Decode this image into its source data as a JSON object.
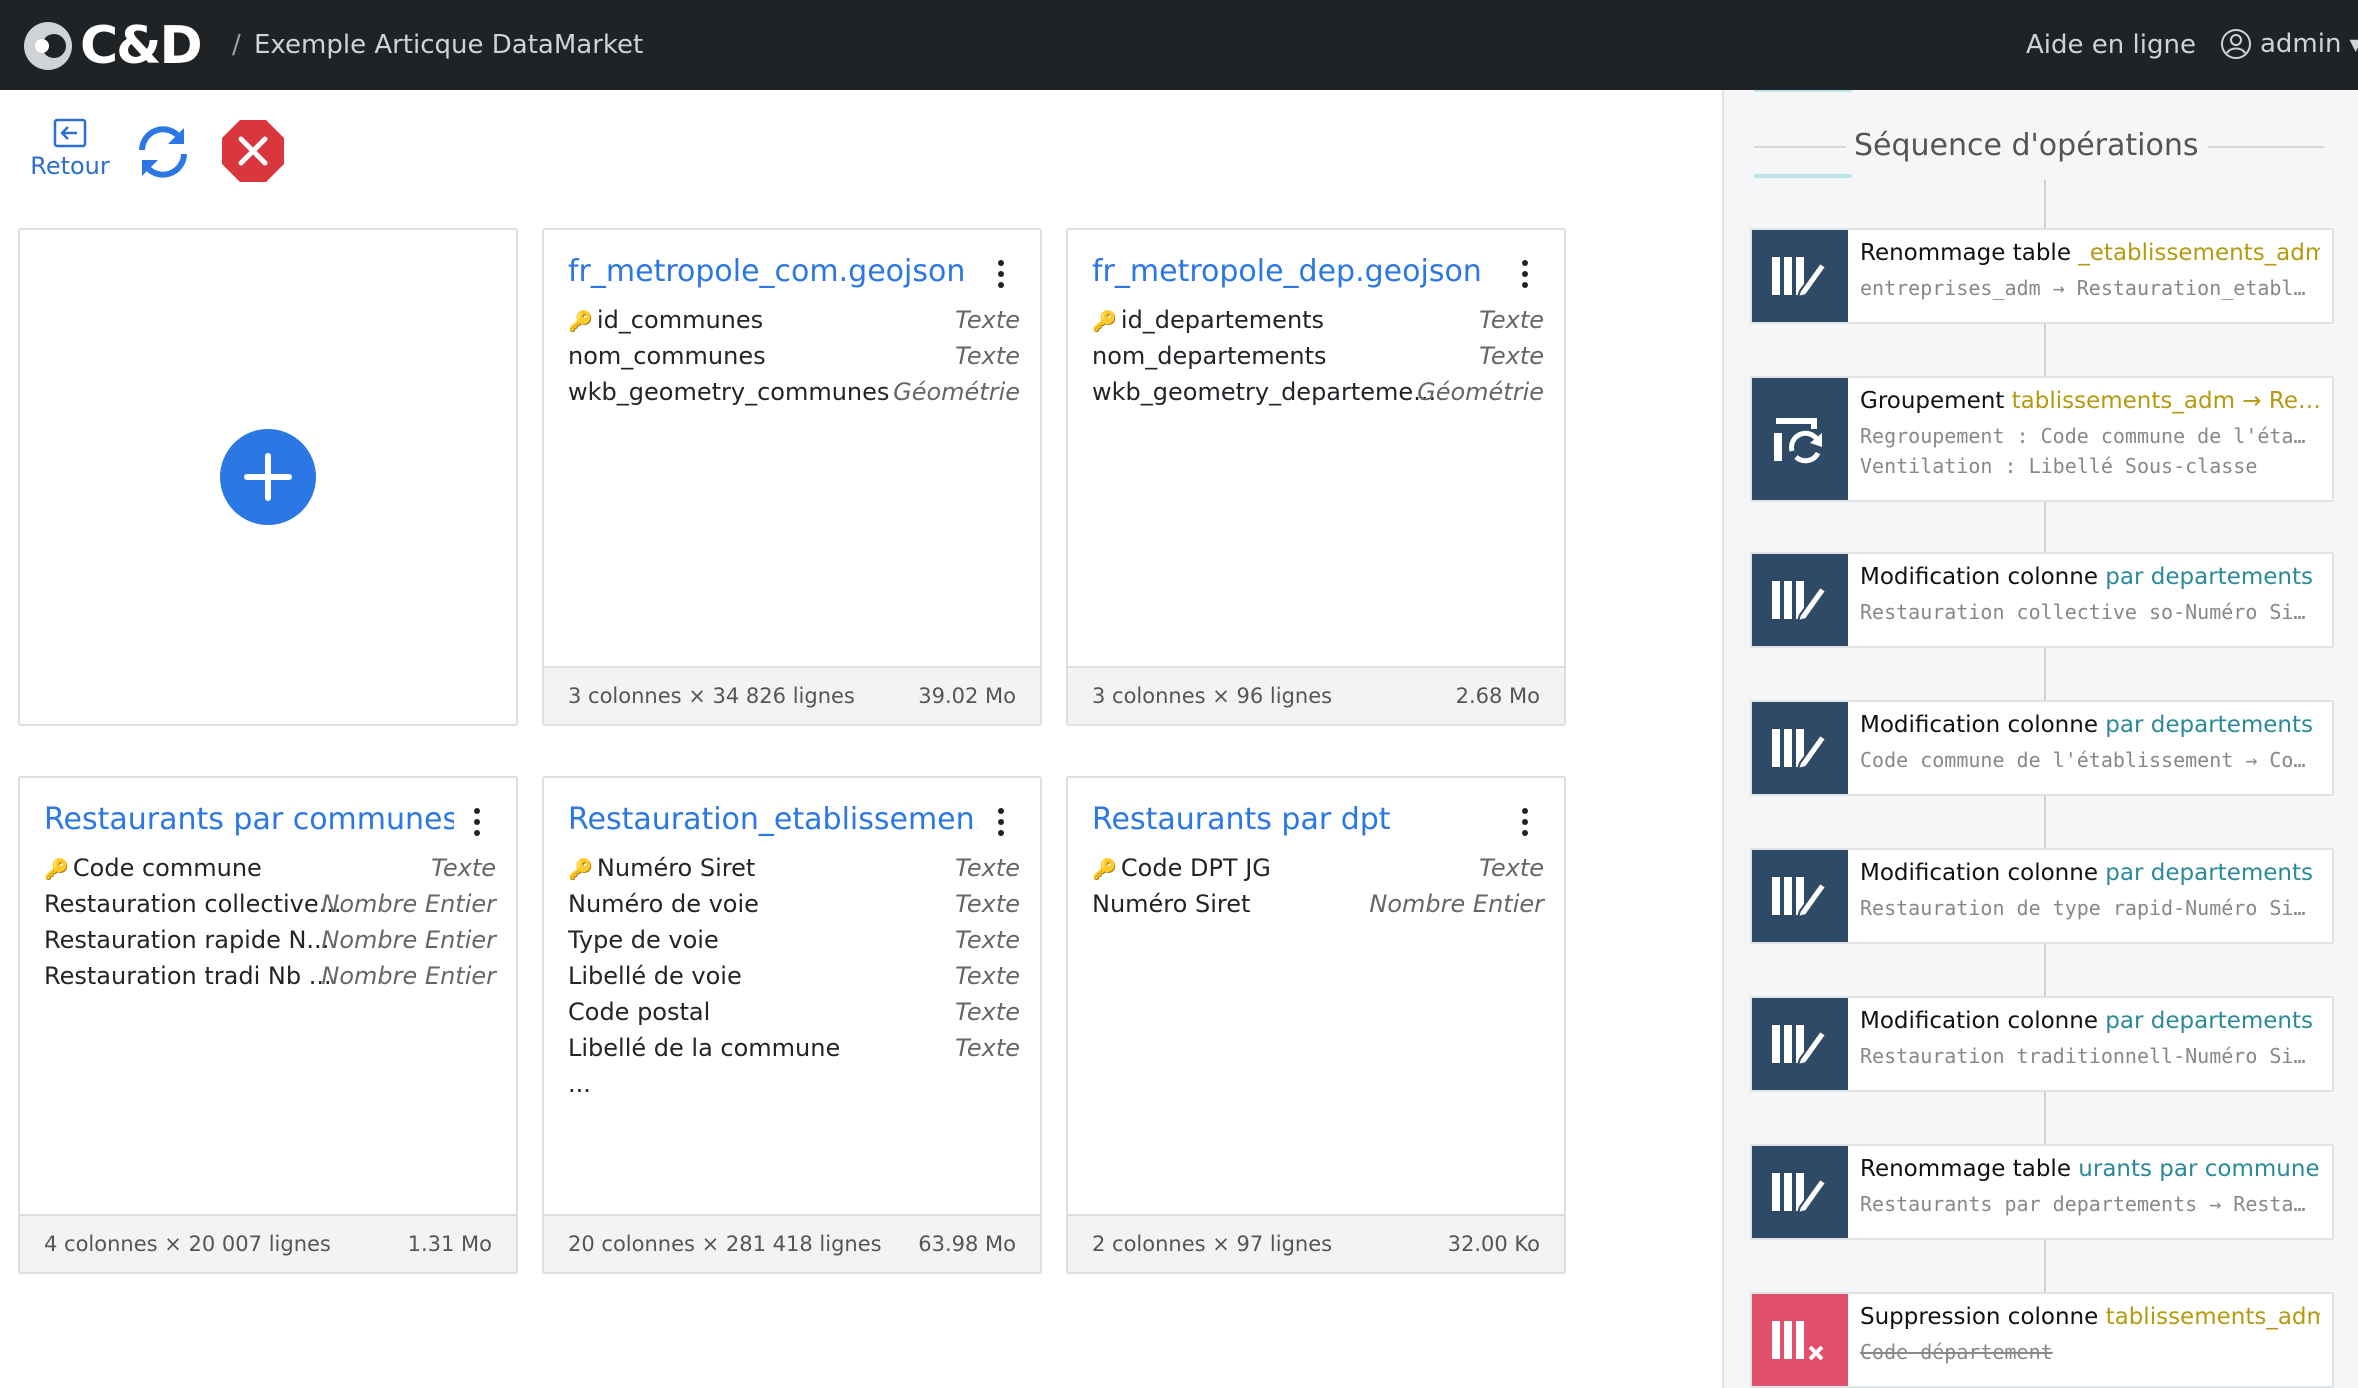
{
  "topbar": {
    "logo_text": "C&D",
    "breadcrumb_sep": "/",
    "breadcrumb": "Exemple Articque DataMarket",
    "help": "Aide en ligne",
    "user": "admin"
  },
  "toolbar": {
    "back_label": "Retour"
  },
  "cards": [
    {
      "title": "fr_metropole_com.geojson",
      "rows": [
        {
          "name": "id_communes",
          "type": "Texte",
          "key": true
        },
        {
          "name": "nom_communes",
          "type": "Texte",
          "key": false
        },
        {
          "name": "wkb_geometry_communes",
          "type": "Géométrie",
          "key": false
        }
      ],
      "footer_left": "3 colonnes × 34 826 lignes",
      "footer_right": "39.02 Mo"
    },
    {
      "title": "fr_metropole_dep.geojson",
      "rows": [
        {
          "name": "id_departements",
          "type": "Texte",
          "key": true
        },
        {
          "name": "nom_departements",
          "type": "Texte",
          "key": false
        },
        {
          "name": "wkb_geometry_departeme...",
          "type": "Géométrie",
          "key": false
        }
      ],
      "footer_left": "3 colonnes × 96 lignes",
      "footer_right": "2.68 Mo"
    },
    {
      "title": "Restaurants par communes",
      "rows": [
        {
          "name": "Code commune",
          "type": "Texte",
          "key": true
        },
        {
          "name": "Restauration collective...",
          "type": "Nombre Entier",
          "key": false
        },
        {
          "name": "Restauration rapide N...",
          "type": "Nombre Entier",
          "key": false
        },
        {
          "name": "Restauration tradi Nb ...",
          "type": "Nombre Entier",
          "key": false
        }
      ],
      "footer_left": "4 colonnes × 20 007 lignes",
      "footer_right": "1.31 Mo"
    },
    {
      "title": "Restauration_etablissemen...",
      "rows": [
        {
          "name": "Numéro Siret",
          "type": "Texte",
          "key": true
        },
        {
          "name": "Numéro de voie",
          "type": "Texte",
          "key": false
        },
        {
          "name": "Type de voie",
          "type": "Texte",
          "key": false
        },
        {
          "name": "Libellé de voie",
          "type": "Texte",
          "key": false
        },
        {
          "name": "Code postal",
          "type": "Texte",
          "key": false
        },
        {
          "name": "Libellé de la commune",
          "type": "Texte",
          "key": false
        },
        {
          "name": "...",
          "type": "",
          "key": false
        }
      ],
      "footer_left": "20 colonnes × 281 418 lignes",
      "footer_right": "63.98 Mo"
    },
    {
      "title": "Restaurants par dpt",
      "rows": [
        {
          "name": "Code DPT JG",
          "type": "Texte",
          "key": true
        },
        {
          "name": "Numéro Siret",
          "type": "Nombre Entier",
          "key": false
        }
      ],
      "footer_left": "2 colonnes × 97 lignes",
      "footer_right": "32.00 Ko"
    }
  ],
  "panel": {
    "title": "Séquence d'opérations",
    "operations": [
      {
        "title": "Renommage table",
        "subject": "_etablissements_adm",
        "subject_style": "gold",
        "lines": [
          "entreprises_adm → Restauration_etabl…"
        ],
        "icon": "rename-table-icon",
        "strike": false
      },
      {
        "title": "Groupement",
        "subject": "tablissements_adm → Re…",
        "subject_style": "gold",
        "lines": [
          "Regroupement : Code commune de l'éta…",
          "Ventilation : Libellé Sous-classe"
        ],
        "icon": "group-icon",
        "strike": false
      },
      {
        "title": "Modification colonne",
        "subject": " par departements",
        "subject_style": "teal",
        "lines": [
          "Restauration collective so-Numéro Si…"
        ],
        "icon": "edit-column-icon",
        "strike": false
      },
      {
        "title": "Modification colonne",
        "subject": " par departements",
        "subject_style": "teal",
        "lines": [
          "Code commune de l'établissement → Co…"
        ],
        "icon": "edit-column-icon",
        "strike": false
      },
      {
        "title": "Modification colonne",
        "subject": " par departements",
        "subject_style": "teal",
        "lines": [
          "Restauration de type rapid-Numéro Si…"
        ],
        "icon": "edit-column-icon",
        "strike": false
      },
      {
        "title": "Modification colonne",
        "subject": " par departements",
        "subject_style": "teal",
        "lines": [
          "Restauration traditionnell-Numéro Si…"
        ],
        "icon": "edit-column-icon",
        "strike": false
      },
      {
        "title": "Renommage table",
        "subject": "urants par communes",
        "subject_style": "teal",
        "lines": [
          "Restaurants par departements → Resta…"
        ],
        "icon": "rename-table-icon",
        "strike": false
      },
      {
        "title": "Suppression colonne",
        "subject": "tablissements_adm",
        "subject_style": "gold",
        "lines": [
          "Code département"
        ],
        "icon": "delete-column-icon",
        "strike": true
      }
    ]
  },
  "colors": {
    "topbar_bg": "#1f2326",
    "accent_blue": "#2b78e4",
    "op_icon_bg": "#2f4a66",
    "op_delete_bg": "#e0506b",
    "stop_button": "#d9363e"
  }
}
